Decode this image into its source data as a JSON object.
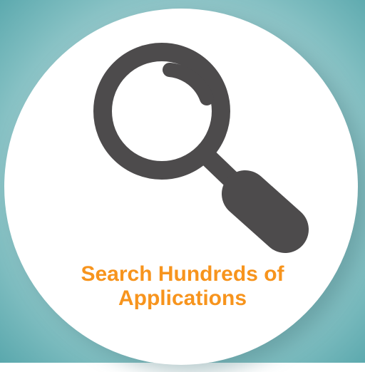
{
  "caption": {
    "line1": "Search Hundreds of",
    "line2": "Applications"
  },
  "icon": "magnifying-glass-icon",
  "colors": {
    "accent": "#f7941d",
    "icon": "#4d4b4c",
    "disc": "#ffffff",
    "background": "#8cc4c6"
  }
}
